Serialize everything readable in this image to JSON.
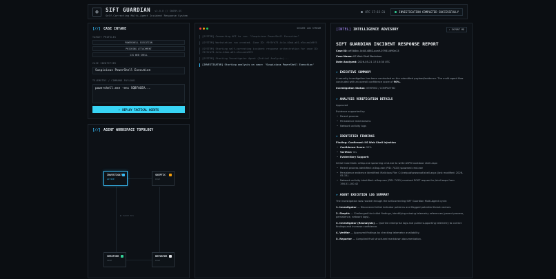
{
  "header": {
    "logo_glyph": "◍",
    "title": "SIFT GUARDIAN",
    "version": "v2.0.0 // SWARM-OS",
    "subtitle": "Self-Correcting Multi-Agent Incident Response System",
    "clock": "UTC 17:15:31",
    "status": "INVESTIGATION COMPLETED SUCCESSFULLY"
  },
  "intake": {
    "title_prefix": "[//]",
    "title": "CASE INTAKE",
    "profiles_label": "TARGET PROFILES",
    "profiles": [
      "POWERSHELL EXECUTION",
      "PHISHING ATTACHMENT",
      "IIS WEB SHELL"
    ],
    "case_label": "CASE IDENTIFIER",
    "case_value": "Suspicious PowerShell Execution",
    "payload_label": "TELEMETRY / COMMAND PAYLOAD",
    "payload_value": "powershell.exe -enc SQBFAGEA...",
    "deploy_label": "DEPLOY TACTICAL AGENTS"
  },
  "topology": {
    "title_prefix": "[//]",
    "title": "AGENT WORKSPACE TOPOLOGY",
    "center": "SWARM BUS",
    "nodes": [
      {
        "name": "INVESTIGATOR",
        "state": "ACTIVE"
      },
      {
        "name": "SKEPTIC",
        "state": "IDLE"
      },
      {
        "name": "VERIFIER",
        "state": "IDLE"
      },
      {
        "name": "REPORTER",
        "state": "IDLE"
      }
    ]
  },
  "logs": {
    "title": "SECURE LOG STREAM",
    "lines": [
      "[SYSTEM] Connecting API to run: \"Suspicious PowerShell Execution\"",
      "[SYSTEM] Workstation run created. Case ID: f9f5fd73-4c1a-40ab-a01-e5ccaa1d9f5",
      "[SYSTEM] Starting self-correcting incident response orchestration for case ID: f9f5fd73-4c1a-40ab-a01-e5ccaa1d9f5",
      "[SYSTEM] Starting Investigator Agent (Initial Analysis)...",
      "[INVESTIGATOR] Starting analysis on case: 'Suspicious PowerShell Execution'"
    ]
  },
  "advisory": {
    "tag": "[INTEL]",
    "title": "INTELLIGENCE ADVISORY",
    "export": "EXPORT MD",
    "report_title": "SIFT GUARDIAN INCIDENT RESPONSE REPORT",
    "meta": [
      {
        "k": "Case ID:",
        "v": "a95b8dc-0c48-4862-aca9-079314f90e13"
      },
      {
        "k": "Case Name:",
        "v": "IIS Web Shell Backdoor"
      },
      {
        "k": "Date Analyzed:",
        "v": "2026-05-21 17:15:30 UTC"
      }
    ],
    "exec_title": "EXECUTIVE SUMMARY",
    "exec_text": "A security investigation has been conducted on the submitted payload/evidence. The multi-agent flow concluded with an overall confidence score of",
    "exec_score": "90%.",
    "exec_status_label": "Investigation Status:",
    "exec_status_value": "VERIFIED / COMPLETED",
    "verify_title": "ANALYSIS VERIFICATION DETAILS",
    "verify_status": "Approved",
    "support_label": "Evidence supported by:",
    "support_items": [
      "Parent process",
      "Persistence mechanisms",
      "Network activity logs"
    ],
    "findings_title": "IDENTIFIED FINDINGS",
    "finding_head": "Finding: Confirmed: IIS Web Shell Injection",
    "finding_items": [
      {
        "k": "Confidence Score:",
        "v": "90%"
      },
      {
        "k": "Verified:",
        "v": "Yes"
      },
      {
        "k": "Evidentiary Support:",
        "v": ""
      }
    ],
    "finding_text": "Initial Case Data: w3wp.exe spawning cmd.exe to write ASPX backdoor shell.aspx",
    "finding_bullets": [
      "Parent process identified: w3wp.exe (PID: 7420) spawned cmd.exe",
      "Persistence evidence identified: Malicious File: C:\\inetpub\\wwwroot\\shell.aspx (last modified: 2026-05-15)",
      "Network activity identified: w3wp.exe (PID: 7420) received POST request to /shell.aspx from 198.51.100.42"
    ],
    "log_title": "AGENT EXECUTION LOG SUMMARY",
    "log_intro": "The investigation was routed through the self-correcting SIFT Guardian Multi-Agent cycle:",
    "log_steps": [
      {
        "k": "1. Investigator",
        "v": "— Discovered initial indicator patterns and flagged potential threat vectors."
      },
      {
        "k": "2. Skeptic",
        "v": "— Challenged the initial findings, identifying missing telemetry references (parent process, persistence, network logs)."
      },
      {
        "k": "3. Investigator (Reanalysis)",
        "v": "— Queried enterprise logs and pulled supporting telemetry to correct findings and increase confidence."
      },
      {
        "k": "4. Verifier",
        "v": "— Approved findings by checking telemetry availability."
      },
      {
        "k": "5. Reporter",
        "v": "— Compiled final structured markdown documentation."
      }
    ]
  }
}
